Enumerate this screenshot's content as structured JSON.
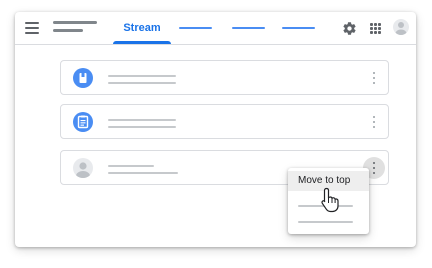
{
  "header": {
    "tabs": [
      {
        "label": "Stream",
        "active": true
      },
      {
        "label": "",
        "active": false
      },
      {
        "label": "",
        "active": false
      },
      {
        "label": "",
        "active": false
      }
    ]
  },
  "context_menu": {
    "items": [
      "Move to top",
      "",
      ""
    ]
  },
  "colors": {
    "accent": "#1a73e8",
    "tab_placeholder": "#4a8df3",
    "card_icon": "#4a8df3",
    "text_placeholder": "#c6c9cc",
    "menu_highlight": "#eeeeee"
  },
  "icons": {
    "menu": "hamburger-icon",
    "settings": "gear-icon",
    "apps": "apps-grid-icon",
    "account": "account-avatar",
    "card_1": "material-icon",
    "card_2": "assignment-icon",
    "card_3": "person-avatar",
    "more": "more-vert-icon",
    "cursor": "hand-pointer-icon"
  }
}
